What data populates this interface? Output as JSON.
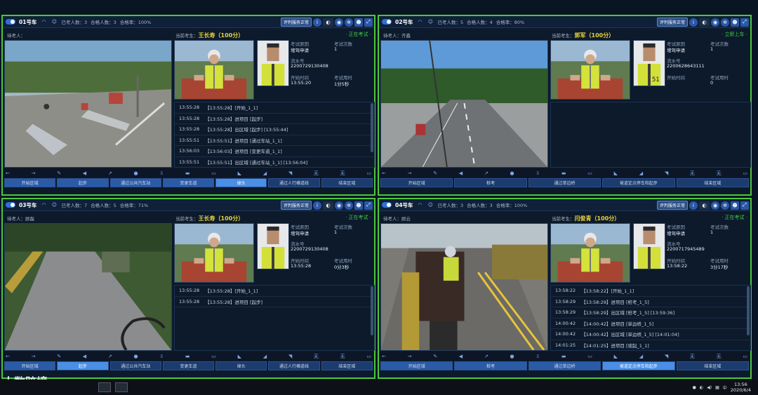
{
  "watermark": "大数跨境",
  "taskbar": {
    "time": "13:56",
    "date": "2020/6/4",
    "ime": "中"
  },
  "panels": [
    {
      "car": "01号车",
      "stat1": "已考人数：3",
      "stat2": "合格人数：3",
      "stat3": "合格率：100%",
      "ctrl": "评判服务正常",
      "waiting": "待考人：",
      "cur_label": "当前考生：",
      "cur_name": "王长寿（100分）",
      "status": "· 正在考试 ·",
      "info": {
        "reason_k": "考试原因",
        "reason_v": "增驾申请",
        "count_k": "考试次数",
        "count_v": "1",
        "serial_k": "流水号",
        "serial_v": "2200729130408",
        "start_k": "开始时间",
        "start_v": "13:55:20",
        "dur_k": "考试用时",
        "dur_v": "1分5秒"
      },
      "log": [
        {
          "t": "13:55:28",
          "e": "【13:55:28】[开始_1_1]"
        },
        {
          "t": "13:55:28",
          "e": "【13:55:28】进项目 [起步]"
        },
        {
          "t": "13:55:28",
          "e": "【13:55:28】出区域 [起步] [13:55:44]"
        },
        {
          "t": "13:55:51",
          "e": "【13:55:51】进项目 [通过车站_1_1]"
        },
        {
          "t": "13:56:03",
          "e": "【13:56:03】进项目 [变更车道_1_1]"
        },
        {
          "t": "13:55:51",
          "e": "【13:55:51】出区域 [通过车站_1_1] [13:56:04]"
        }
      ],
      "steps": [
        "开始区域",
        "起步",
        "通过公共汽车站",
        "变更车道",
        "掉头",
        "通过人行横道线",
        "结束区域"
      ],
      "active": 4
    },
    {
      "car": "02号车",
      "stat1": "已考人数：5",
      "stat2": "合格人数：4",
      "stat3": "合格率：80%",
      "ctrl": "评判服务正常",
      "waiting": "待考人：齐鑫",
      "cur_label": "当前考生：",
      "cur_name": "郭军（100分）",
      "status": "· 立即上车 ·",
      "info": {
        "reason_k": "考试原因",
        "reason_v": "增驾申请",
        "count_k": "考试次数",
        "count_v": "1",
        "serial_k": "流水号",
        "serial_v": "2200628643111",
        "start_k": "开始时间",
        "start_v": "",
        "dur_k": "考试用时",
        "dur_v": "0"
      },
      "log": [],
      "steps": [
        "开始区域",
        "桩考",
        "通过单边桥",
        "坡道定点停车和起步",
        "结束区域"
      ],
      "active": -1
    },
    {
      "car": "03号车",
      "stat1": "已考人数：7",
      "stat2": "合格人数：5",
      "stat3": "合格率：71%",
      "ctrl": "评判服务正常",
      "waiting": "待考人：顾磊",
      "cur_label": "当前考生：",
      "cur_name": "王长寿（100分）",
      "status": "· 正在考试 ·",
      "info": {
        "reason_k": "考试原因",
        "reason_v": "增驾申请",
        "count_k": "考试次数",
        "count_v": "1",
        "serial_k": "流水号",
        "serial_v": "2200729130408",
        "start_k": "开始时间",
        "start_v": "13:55:28",
        "dur_k": "考试用时",
        "dur_v": "0分3秒"
      },
      "log": [
        {
          "t": "13:55:28",
          "e": "【13:55:28】[开始_1_1]"
        },
        {
          "t": "13:55:28",
          "e": "【13:55:28】进项目 [起步]"
        }
      ],
      "steps": [
        "开始区域",
        "起步",
        "通过公共汽车站",
        "变更车道",
        "掉头",
        "通过人行横道线",
        "结束区域"
      ],
      "active": 1
    },
    {
      "car": "04号车",
      "stat1": "已考人数：3",
      "stat2": "合格人数：3",
      "stat3": "合格率：100%",
      "ctrl": "评判服务正常",
      "waiting": "待考人：顾云",
      "cur_label": "当前考生：",
      "cur_name": "闫俊青（100分）",
      "status": "· 正在考试 ·",
      "info": {
        "reason_k": "考试原因",
        "reason_v": "增驾申请",
        "count_k": "考试次数",
        "count_v": "1",
        "serial_k": "流水号",
        "serial_v": "2200717945489",
        "start_k": "开始时间",
        "start_v": "13:58:22",
        "dur_k": "考试用时",
        "dur_v": "3分17秒"
      },
      "log": [
        {
          "t": "13:58:22",
          "e": "【13:58:22】[开始_1_1]"
        },
        {
          "t": "13:58:29",
          "e": "【13:58:29】进项目 [桩考_1_5]"
        },
        {
          "t": "13:58:29",
          "e": "【13:58:29】出区域 [桩考_1_5] [13:59:36]"
        },
        {
          "t": "14:00:42",
          "e": "【14:00:42】进项目 [单边桥_1_5]"
        },
        {
          "t": "14:00:42",
          "e": "【14:00:42】出区域 [单边桥_1_5] [14:01:04]"
        },
        {
          "t": "14:01:25",
          "e": "【14:01:25】进项目 [坡起_1_1]"
        }
      ],
      "steps": [
        "开始区域",
        "桩考",
        "通过单边桥",
        "坡道定点停车和起步",
        "结束区域"
      ],
      "active": 3
    }
  ],
  "toolbar_icons": [
    "←",
    "→",
    "✎",
    "◀",
    "↗",
    "●",
    "⇩",
    "▬",
    "▭",
    "◣",
    "◢",
    "◥",
    "无",
    "无",
    "▭"
  ]
}
